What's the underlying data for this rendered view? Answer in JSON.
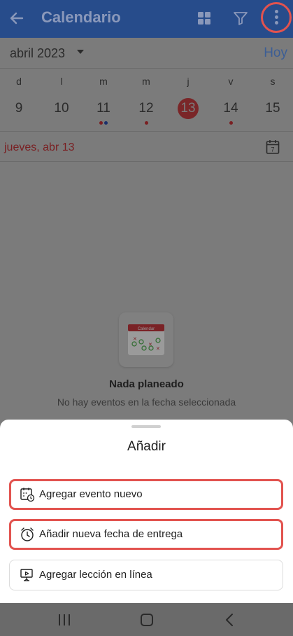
{
  "topbar": {
    "title": "Calendario",
    "icons": [
      "back-arrow-icon",
      "grid-view-icon",
      "filter-icon",
      "more-vert-icon"
    ]
  },
  "month": {
    "label": "abril 2023",
    "today": "Hoy"
  },
  "week": {
    "weekdays": [
      "d",
      "l",
      "m",
      "m",
      "j",
      "v",
      "s"
    ],
    "days": [
      {
        "num": "9",
        "dots": []
      },
      {
        "num": "10",
        "dots": []
      },
      {
        "num": "11",
        "dots": [
          "#7a1f22",
          "#1a2f6b"
        ]
      },
      {
        "num": "12",
        "dots": [
          "#7a1f22"
        ]
      },
      {
        "num": "13",
        "dots": [],
        "selected": true
      },
      {
        "num": "14",
        "dots": [
          "#7a1f22"
        ]
      },
      {
        "num": "15",
        "dots": []
      }
    ]
  },
  "selected_date": {
    "label": "jueves, abr 13",
    "calendar_icon_day": "7"
  },
  "empty": {
    "art_label": "Calendar",
    "title": "Nada planeado",
    "subtitle": "No hay eventos en la fecha seleccionada"
  },
  "sheet": {
    "title": "Añadir",
    "options": [
      {
        "label": "Agregar evento nuevo",
        "icon": "calendar-event-icon",
        "highlighted": true
      },
      {
        "label": "Añadir nueva fecha de entrega",
        "icon": "alarm-clock-icon",
        "highlighted": true
      },
      {
        "label": "Agregar lección en línea",
        "icon": "online-lesson-icon",
        "highlighted": false
      }
    ]
  },
  "colors": {
    "highlight_outline": "#e2534f",
    "topbar_bg": "#274c8b",
    "selected_day": "#7a2628",
    "date_label": "#7a1f22"
  }
}
